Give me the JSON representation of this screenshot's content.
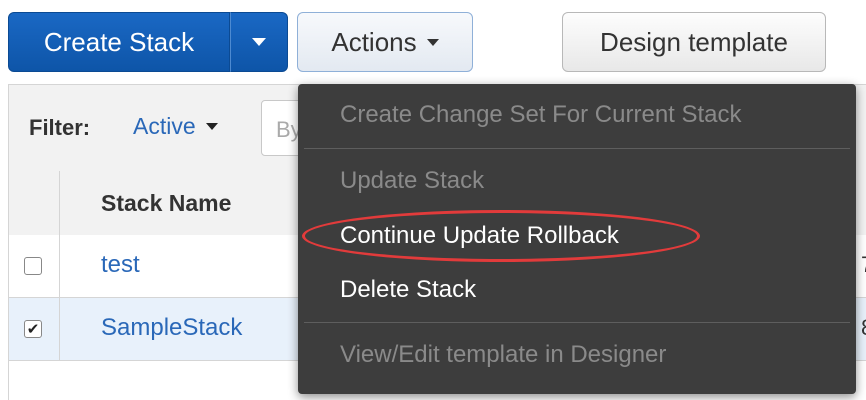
{
  "toolbar": {
    "create_stack_label": "Create Stack",
    "actions_label": "Actions",
    "design_template_label": "Design template"
  },
  "filter": {
    "label": "Filter:",
    "value": "Active",
    "input_placeholder": "By"
  },
  "table": {
    "columns": [
      "Stack Name"
    ],
    "rows": [
      {
        "name": "test",
        "checked": false,
        "edge_text": "7"
      },
      {
        "name": "SampleStack",
        "checked": true,
        "edge_text": "8"
      }
    ]
  },
  "actions_menu": {
    "items": [
      {
        "label": "Create Change Set For Current Stack",
        "enabled": false
      },
      {
        "label": "Update Stack",
        "enabled": false
      },
      {
        "label": "Continue Update Rollback",
        "enabled": true,
        "highlighted": true
      },
      {
        "label": "Delete Stack",
        "enabled": true
      },
      {
        "label": "View/Edit template in Designer",
        "enabled": false
      }
    ]
  },
  "colors": {
    "primary_button": "#1a68c4",
    "menu_background": "#3d3d3d",
    "link": "#2a68b8",
    "highlight_ring": "#e23b3b",
    "selected_row": "#e8f1fb"
  }
}
